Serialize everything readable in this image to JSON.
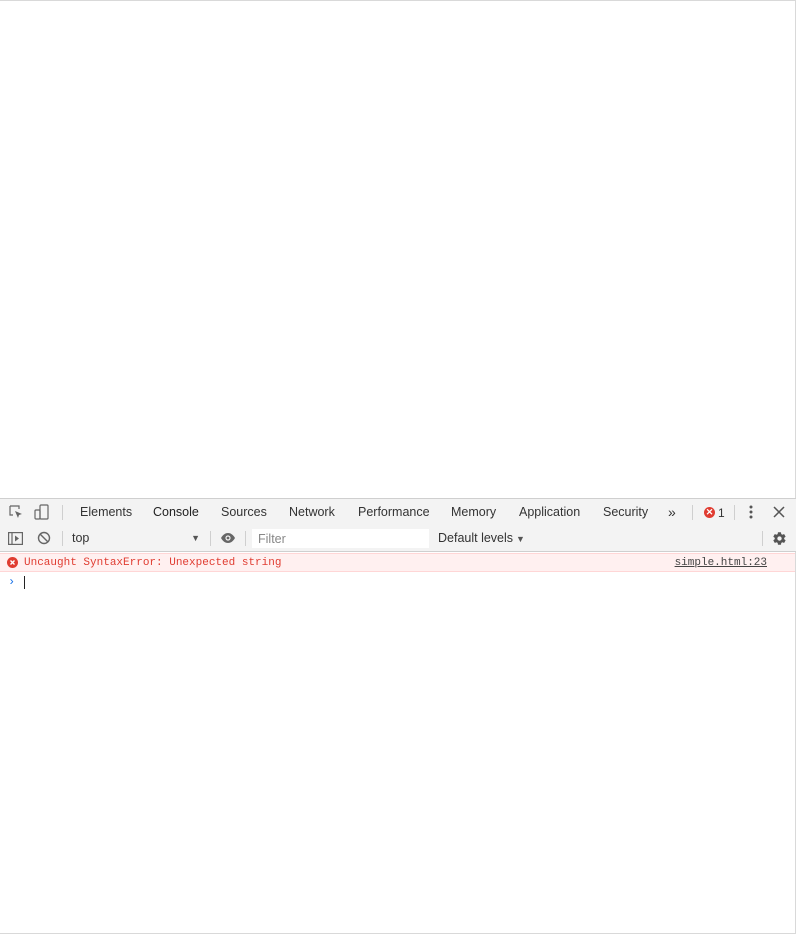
{
  "devtools": {
    "tabs": [
      "Elements",
      "Console",
      "Sources",
      "Network",
      "Performance",
      "Memory",
      "Application",
      "Security"
    ],
    "active_tab": "Console",
    "more_tabs_glyph": "»",
    "error_count": "1",
    "icons": {
      "inspect": "inspect-element-icon",
      "device": "device-toolbar-icon",
      "more": "kebab-menu-icon",
      "close": "close-icon"
    }
  },
  "console": {
    "context": "top",
    "filter_placeholder": "Filter",
    "filter_value": "",
    "levels_label": "Default levels",
    "messages": [
      {
        "level": "error",
        "text": "Uncaught SyntaxError: Unexpected string",
        "source": "simple.html:23"
      }
    ],
    "prompt_glyph": "›"
  },
  "colors": {
    "accent": "#1a73e8",
    "error": "#e03c31",
    "error_bg": "#fff0f0",
    "toolbar_bg": "#f3f3f3"
  }
}
